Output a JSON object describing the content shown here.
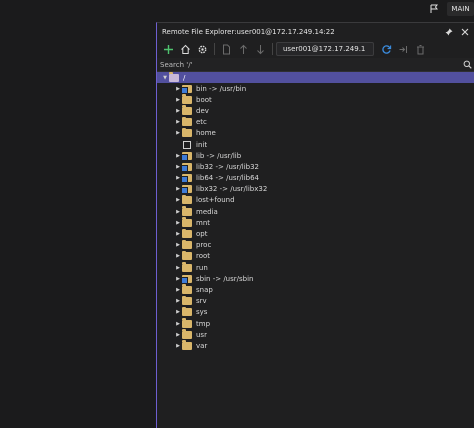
{
  "topbar": {
    "feedback_icon": "feedback-flag-icon",
    "main_label": "MAIN"
  },
  "panel": {
    "title": "Remote File Explorer:user001@172.17.249.14:22",
    "pin_icon": "pin-icon",
    "close_icon": "close-icon"
  },
  "toolbar": {
    "icons": [
      "add-icon",
      "home-icon",
      "settings-icon",
      "new-file-icon",
      "upload-icon",
      "download-icon"
    ],
    "connection": "user001@172.17.249.1",
    "action_icons": [
      "refresh-icon",
      "disconnect-icon",
      "delete-icon"
    ]
  },
  "search": {
    "placeholder": "Search '/'"
  },
  "tree": {
    "root": "/",
    "entries": [
      {
        "name": "bin -> /usr/bin",
        "kind": "link"
      },
      {
        "name": "boot",
        "kind": "folder"
      },
      {
        "name": "dev",
        "kind": "folder"
      },
      {
        "name": "etc",
        "kind": "folder"
      },
      {
        "name": "home",
        "kind": "folder"
      },
      {
        "name": "init",
        "kind": "file"
      },
      {
        "name": "lib -> /usr/lib",
        "kind": "link"
      },
      {
        "name": "lib32 -> /usr/lib32",
        "kind": "link"
      },
      {
        "name": "lib64 -> /usr/lib64",
        "kind": "link"
      },
      {
        "name": "libx32 -> /usr/libx32",
        "kind": "link"
      },
      {
        "name": "lost+found",
        "kind": "folder"
      },
      {
        "name": "media",
        "kind": "folder"
      },
      {
        "name": "mnt",
        "kind": "folder"
      },
      {
        "name": "opt",
        "kind": "folder"
      },
      {
        "name": "proc",
        "kind": "folder"
      },
      {
        "name": "root",
        "kind": "folder"
      },
      {
        "name": "run",
        "kind": "folder"
      },
      {
        "name": "sbin -> /usr/sbin",
        "kind": "link"
      },
      {
        "name": "snap",
        "kind": "folder"
      },
      {
        "name": "srv",
        "kind": "folder"
      },
      {
        "name": "sys",
        "kind": "folder"
      },
      {
        "name": "tmp",
        "kind": "folder"
      },
      {
        "name": "usr",
        "kind": "folder"
      },
      {
        "name": "var",
        "kind": "folder"
      }
    ]
  },
  "colors": {
    "accent": "#6e5fd0",
    "selection": "#52509e",
    "folder": "#d9b66a",
    "link_badge": "#3e7bd6",
    "add_green": "#4fc36e",
    "refresh_blue": "#3b8de0"
  }
}
